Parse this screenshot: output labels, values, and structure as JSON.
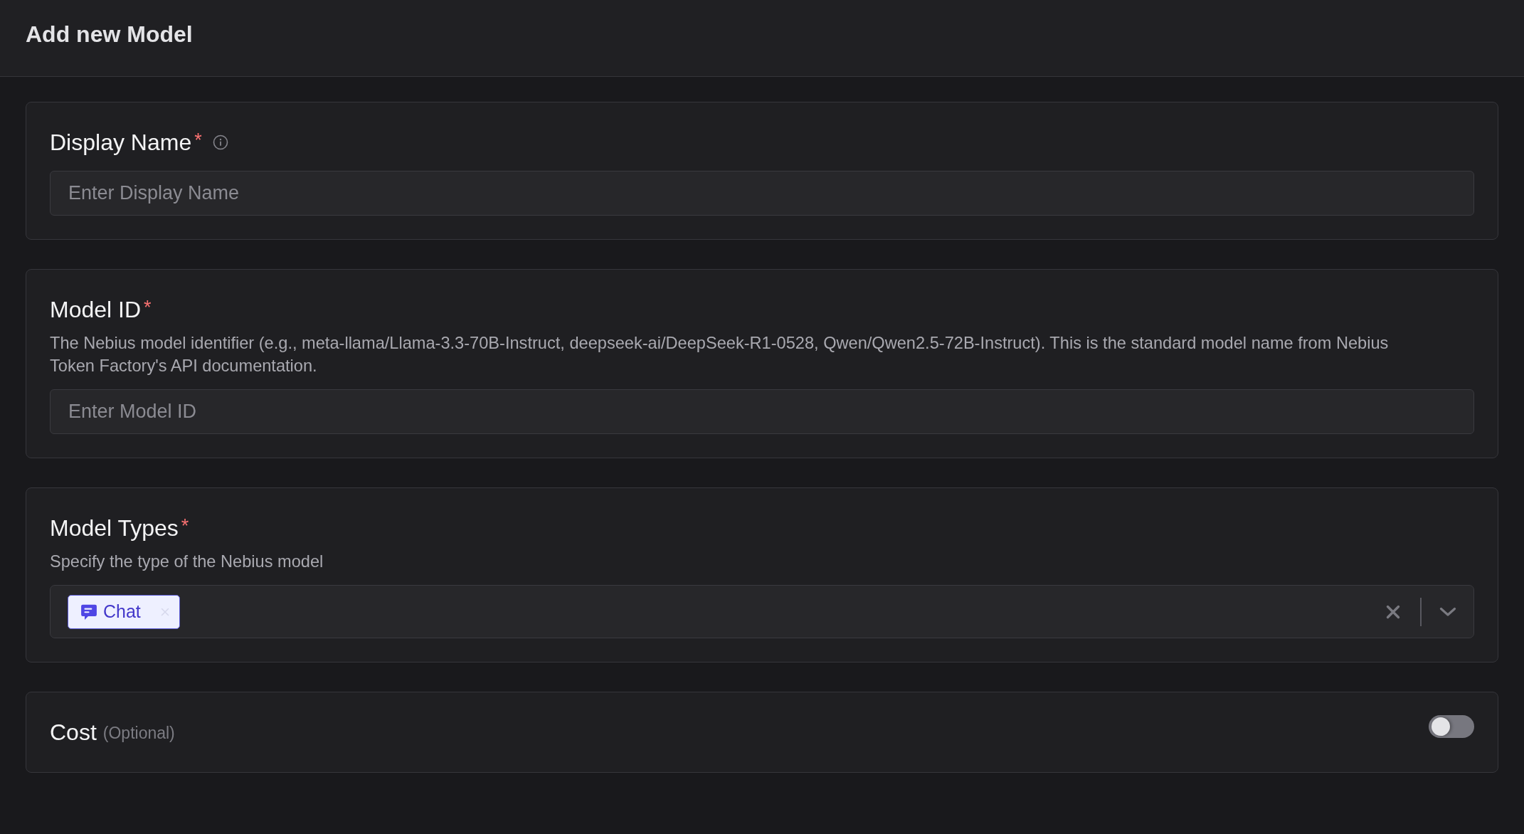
{
  "header": {
    "title": "Add new Model"
  },
  "sections": [
    {
      "kind": "text",
      "label": "Display Name",
      "required_mark": "*",
      "info": true,
      "placeholder": "Enter Display Name"
    },
    {
      "kind": "text",
      "label": "Model ID",
      "required_mark": "*",
      "description": "The Nebius model identifier (e.g., meta-llama/Llama-3.3-70B-Instruct, deepseek-ai/DeepSeek-R1-0528, Qwen/Qwen2.5-72B-Instruct). This is the standard model name from Nebius Token Factory's API documentation.",
      "placeholder": "Enter Model ID"
    },
    {
      "kind": "select",
      "label": "Model Types",
      "required_mark": "*",
      "description": "Specify the type of the Nebius model",
      "values": [
        {
          "label": "Chat"
        }
      ]
    },
    {
      "kind": "toggle",
      "label": "Cost",
      "note": "(Optional)",
      "on": false
    }
  ]
}
